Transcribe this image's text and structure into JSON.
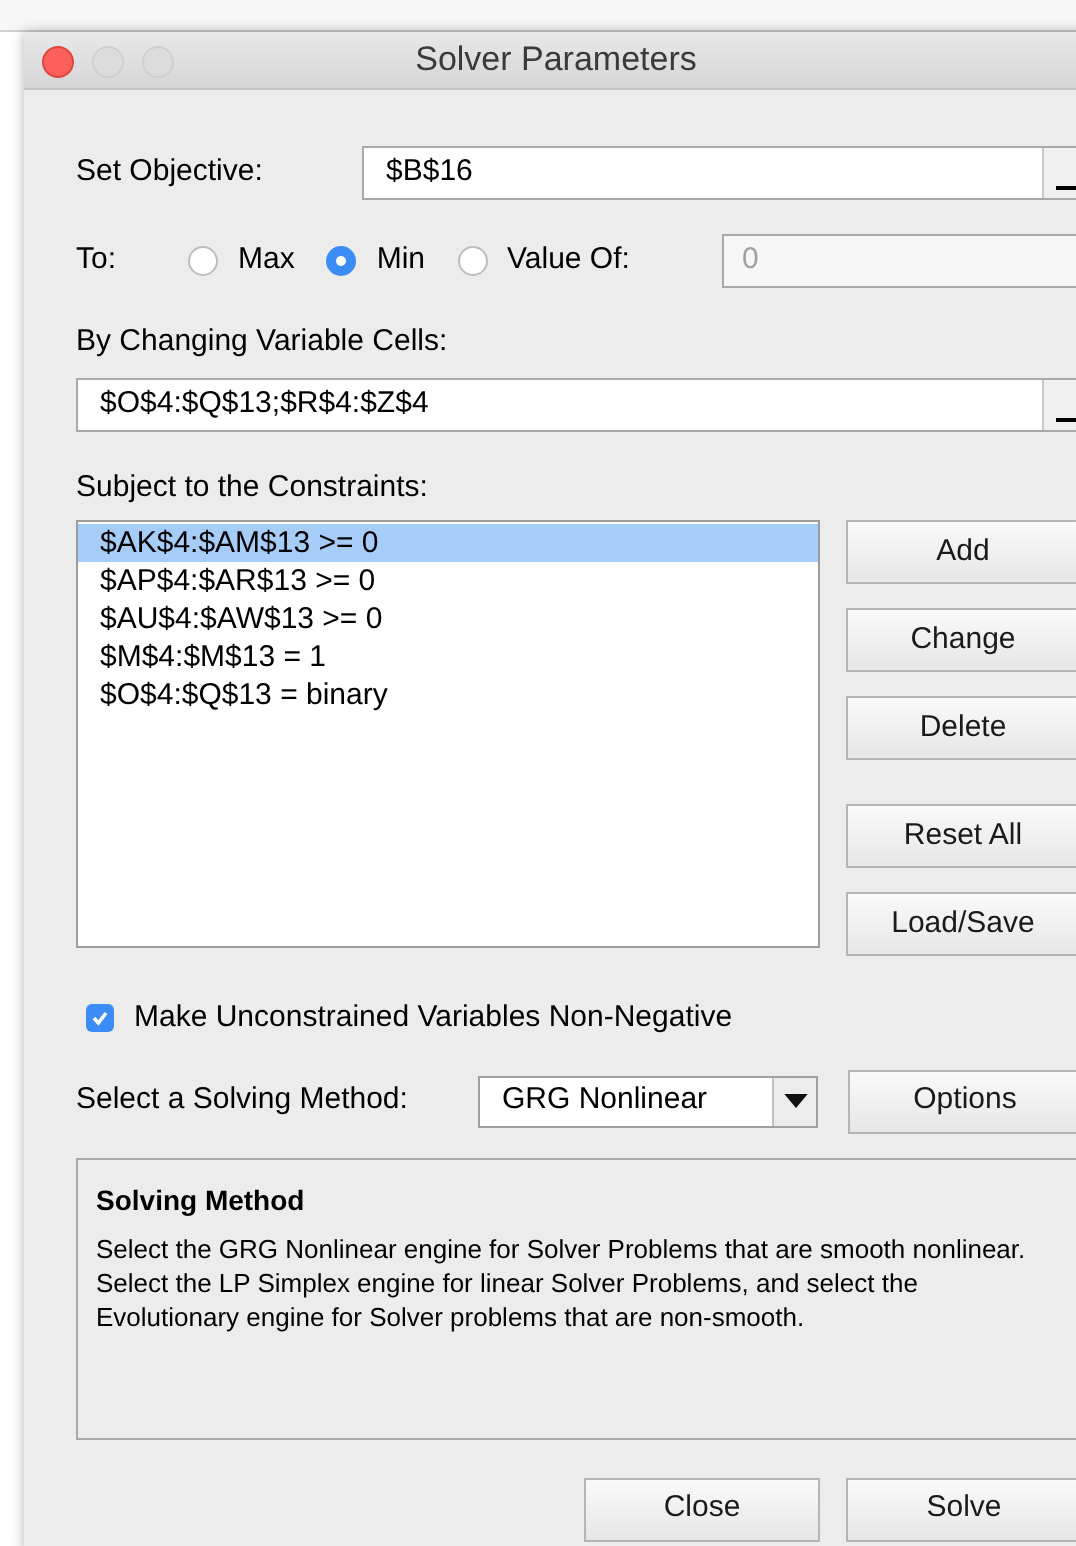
{
  "window": {
    "title": "Solver Parameters"
  },
  "objective": {
    "label": "Set Objective:",
    "value": "$B$16"
  },
  "to": {
    "label": "To:",
    "options": [
      {
        "label": "Max",
        "selected": false
      },
      {
        "label": "Min",
        "selected": true
      },
      {
        "label": "Value Of:",
        "selected": false
      }
    ],
    "value_field": {
      "value": "0",
      "disabled": true
    }
  },
  "changing_cells": {
    "label": "By Changing Variable Cells:",
    "value": "$O$4:$Q$13;$R$4:$Z$4"
  },
  "constraints": {
    "label": "Subject to the Constraints:",
    "items": [
      {
        "text": "$AK$4:$AM$13 >= 0",
        "selected": true
      },
      {
        "text": "$AP$4:$AR$13 >= 0",
        "selected": false
      },
      {
        "text": "$AU$4:$AW$13 >= 0",
        "selected": false
      },
      {
        "text": "$M$4:$M$13 = 1",
        "selected": false
      },
      {
        "text": "$O$4:$Q$13 = binary",
        "selected": false
      }
    ],
    "buttons": [
      "Add",
      "Change",
      "Delete",
      "Reset All",
      "Load/Save"
    ]
  },
  "nonnegative": {
    "label": "Make Unconstrained Variables Non-Negative",
    "checked": true
  },
  "method": {
    "label": "Select a Solving Method:",
    "value": "GRG Nonlinear",
    "options_button": "Options"
  },
  "description": {
    "title": "Solving Method",
    "text": "Select the GRG Nonlinear engine for Solver Problems that are smooth nonlinear. Select the LP Simplex engine for linear Solver Problems, and select the Evolutionary engine for Solver problems that are non-smooth."
  },
  "footer_buttons": [
    "Close",
    "Solve"
  ]
}
